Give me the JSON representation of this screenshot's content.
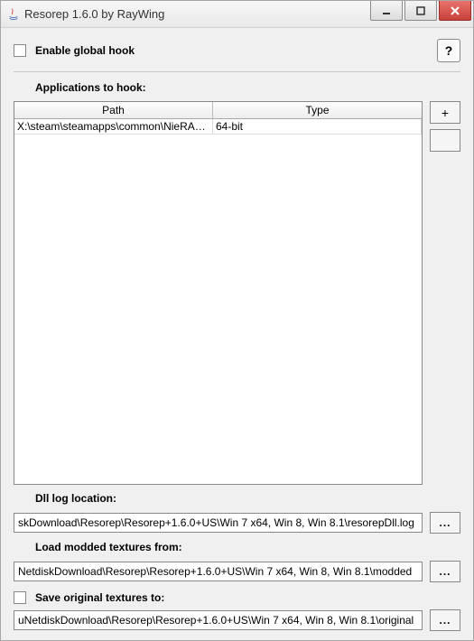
{
  "window": {
    "title": "Resorep 1.6.0 by RayWing"
  },
  "top": {
    "enable_hook_label": "Enable global hook",
    "help_label": "?"
  },
  "apps": {
    "heading": "Applications to hook:",
    "col_path": "Path",
    "col_type": "Type",
    "rows": [
      {
        "path": "X:\\steam\\steamapps\\common\\NieRAu...",
        "type": "64-bit"
      }
    ],
    "add_label": "+",
    "remove_label": ""
  },
  "dll": {
    "heading": "Dll log location:",
    "value": "skDownload\\Resorep\\Resorep+1.6.0+US\\Win 7 x64, Win 8, Win 8.1\\resorepDll.log",
    "browse": "..."
  },
  "modded": {
    "heading": "Load modded textures from:",
    "value": "NetdiskDownload\\Resorep\\Resorep+1.6.0+US\\Win 7 x64, Win 8, Win 8.1\\modded",
    "browse": "..."
  },
  "original": {
    "heading": "Save original textures to:",
    "value": "uNetdiskDownload\\Resorep\\Resorep+1.6.0+US\\Win 7 x64, Win 8, Win 8.1\\original",
    "browse": "..."
  }
}
